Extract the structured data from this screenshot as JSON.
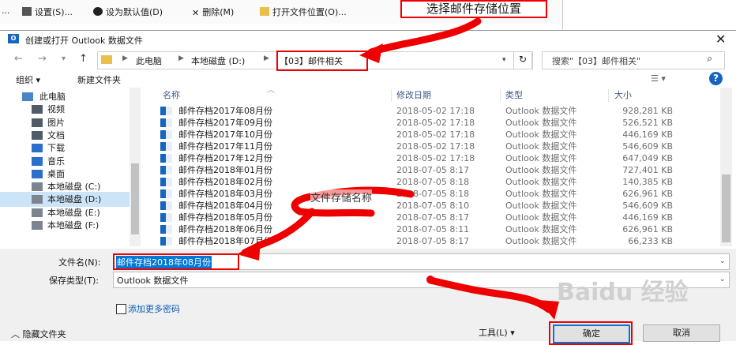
{
  "bg_toolbar": {
    "items": [
      "...",
      "设置(S)...",
      "设为默认值(D)",
      "删除(M)",
      "打开文件位置(O)..."
    ],
    "annotation": "选择邮件存储位置"
  },
  "dialog": {
    "title": "创建或打开 Outlook 数据文件",
    "app_icon": "O",
    "breadcrumb": [
      "此电脑",
      "本地磁盘 (D:)",
      "【03】邮件相关"
    ],
    "search_placeholder": "搜索\"【03】邮件相关\"",
    "toolbar": {
      "organize": "组织 ▾",
      "new_folder": "新建文件夹"
    }
  },
  "nav": [
    {
      "label": "此电脑",
      "icon": "computer-icon",
      "indent": 0
    },
    {
      "label": "视频",
      "icon": "video-icon",
      "indent": 1
    },
    {
      "label": "图片",
      "icon": "picture-icon",
      "indent": 1
    },
    {
      "label": "文档",
      "icon": "document-icon",
      "indent": 1
    },
    {
      "label": "下载",
      "icon": "download-icon",
      "indent": 1
    },
    {
      "label": "音乐",
      "icon": "music-icon",
      "indent": 1
    },
    {
      "label": "桌面",
      "icon": "desktop-icon",
      "indent": 1
    },
    {
      "label": "本地磁盘 (C:)",
      "icon": "drive-icon",
      "indent": 1
    },
    {
      "label": "本地磁盘 (D:)",
      "icon": "drive-icon",
      "indent": 1,
      "selected": true
    },
    {
      "label": "本地磁盘 (E:)",
      "icon": "drive-icon",
      "indent": 1
    },
    {
      "label": "本地磁盘 (F:)",
      "icon": "drive-icon",
      "indent": 1
    }
  ],
  "columns": [
    "名称",
    "修改日期",
    "类型",
    "大小"
  ],
  "files": [
    {
      "name": "邮件存档2017年08月份",
      "date": "2018-05-02 17:18",
      "type": "Outlook 数据文件",
      "size": "928,281 KB"
    },
    {
      "name": "邮件存档2017年09月份",
      "date": "2018-05-02 17:18",
      "type": "Outlook 数据文件",
      "size": "526,521 KB"
    },
    {
      "name": "邮件存档2017年10月份",
      "date": "2018-05-02 17:18",
      "type": "Outlook 数据文件",
      "size": "446,169 KB"
    },
    {
      "name": "邮件存档2017年11月份",
      "date": "2018-05-02 17:18",
      "type": "Outlook 数据文件",
      "size": "546,609 KB"
    },
    {
      "name": "邮件存档2017年12月份",
      "date": "2018-05-02 17:18",
      "type": "Outlook 数据文件",
      "size": "647,049 KB"
    },
    {
      "name": "邮件存档2018年01月份",
      "date": "2018-07-05 8:17",
      "type": "Outlook 数据文件",
      "size": "727,401 KB"
    },
    {
      "name": "邮件存档2018年02月份",
      "date": "2018-07-05 8:18",
      "type": "Outlook 数据文件",
      "size": "140,385 KB"
    },
    {
      "name": "邮件存档2018年03月份",
      "date": "2018-07-05 8:18",
      "type": "Outlook 数据文件",
      "size": "626,961 KB"
    },
    {
      "name": "邮件存档2018年04月份",
      "date": "2018-07-05 8:10",
      "type": "Outlook 数据文件",
      "size": "546,609 KB"
    },
    {
      "name": "邮件存档2018年05月份",
      "date": "2018-07-05 8:17",
      "type": "Outlook 数据文件",
      "size": "446,169 KB"
    },
    {
      "name": "邮件存档2018年06月份",
      "date": "2018-07-05 8:11",
      "type": "Outlook 数据文件",
      "size": "626,961 KB"
    },
    {
      "name": "邮件存档2018年07月份",
      "date": "2018-07-05 8:17",
      "type": "Outlook 数据文件",
      "size": "66,233 KB"
    }
  ],
  "filename_label": "文件名(N):",
  "filename_value": "邮件存档2018年08月份",
  "savetype_label": "保存类型(T):",
  "savetype_value": "Outlook 数据文件",
  "add_password": "添加更多密码",
  "hide_folders": "隐藏文件夹",
  "tools": "工具(L)",
  "ok": "确定",
  "cancel": "取消",
  "annotation_filename": "文件存储名称",
  "watermark": "Baidu 经验"
}
